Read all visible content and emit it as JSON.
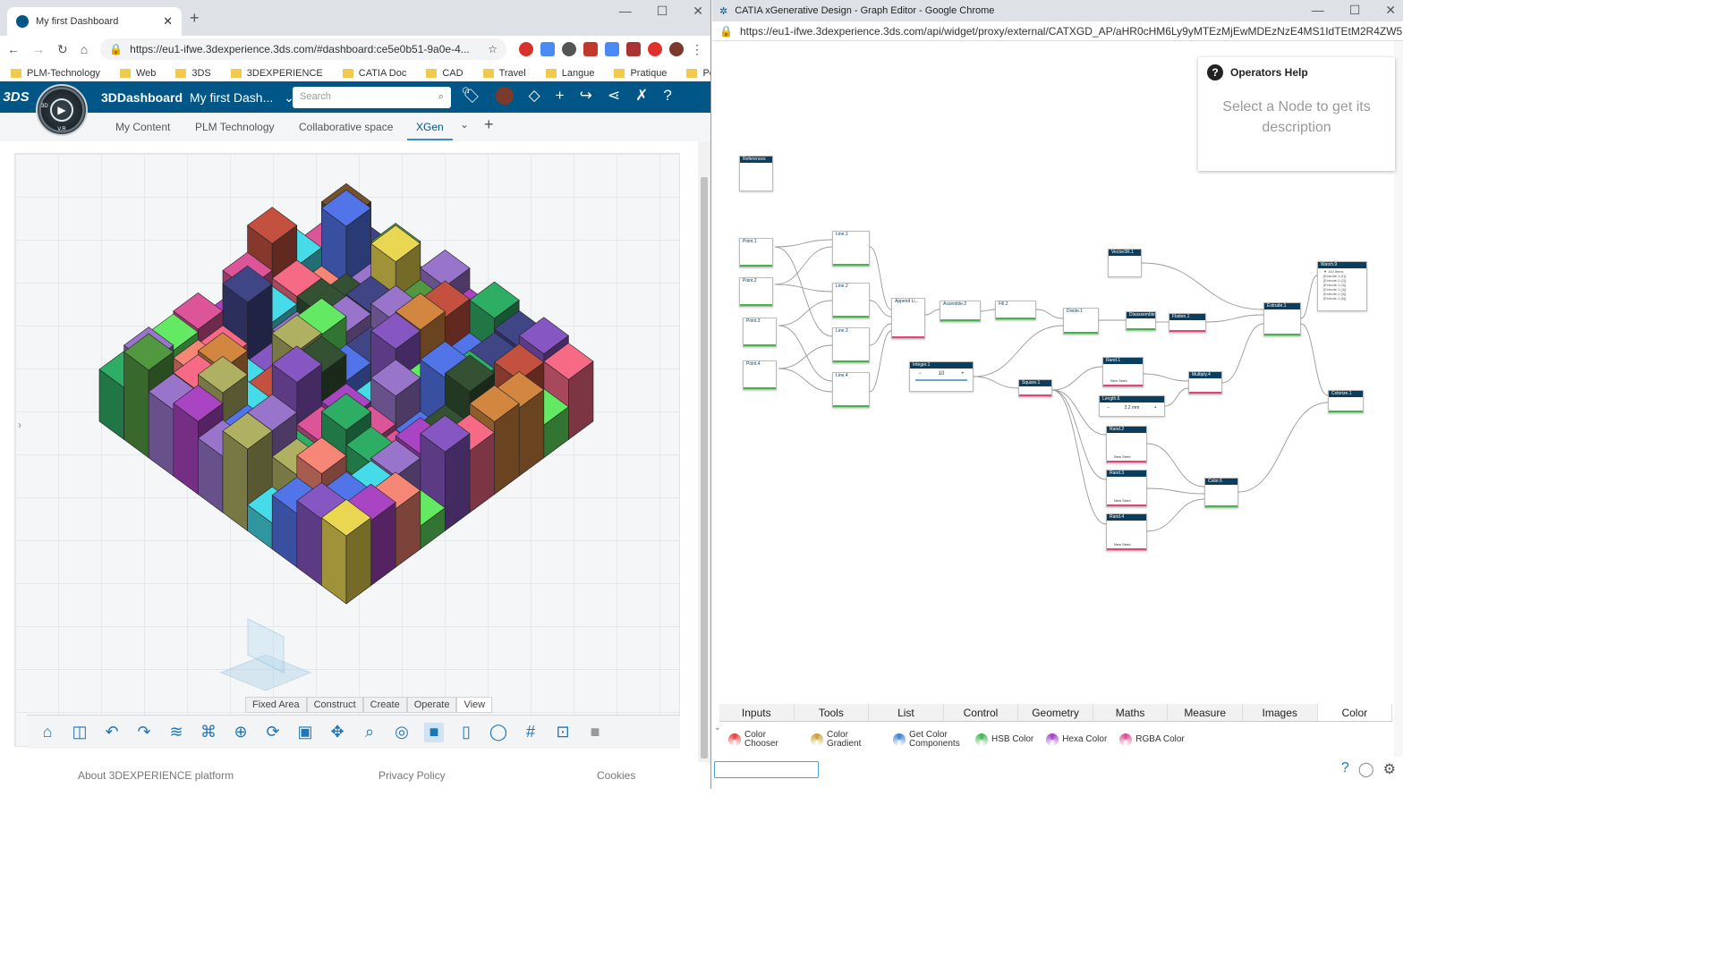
{
  "left_window": {
    "tab_title": "My first Dashboard",
    "url": "https://eu1-ifwe.3dexperience.3ds.com/#dashboard:ce5e0b51-9a0e-4...",
    "bookmarks": [
      "PLM-Technology",
      "Web",
      "3DS",
      "3DEXPERIENCE",
      "CATIA Doc",
      "CAD",
      "Travel",
      "Langue",
      "Pratique",
      "Personnel"
    ],
    "app_name": "3DDashboard",
    "dashboard_name": "My first Dash...",
    "search_placeholder": "Search",
    "compass_labels": {
      "top_left": "3D",
      "bottom": "V.R"
    },
    "dash_tabs": [
      "My Content",
      "PLM Technology",
      "Collaborative space",
      "XGen"
    ],
    "viewer_tabs": [
      "Fixed Area",
      "Construct",
      "Create",
      "Operate",
      "View"
    ],
    "active_viewer_tab": "View",
    "footer": [
      "About 3DEXPERIENCE platform",
      "Privacy Policy",
      "Cookies"
    ]
  },
  "right_window": {
    "title": "CATIA xGenerative Design - Graph Editor - Google Chrome",
    "url": "https://eu1-ifwe.3dexperience.3ds.com/api/widget/proxy/external/CATXGD_AP/aHR0cHM6Ly9yMTEzMjEwMDEzNzE4MS1IdTEtM2R4ZW5nYXB...",
    "help": {
      "title": "Operators Help",
      "text": "Select a Node to get its description"
    },
    "nodes": {
      "references": "References",
      "point1": "Point.1",
      "point2": "Point.2",
      "point3": "Point.3",
      "point4": "Point.4",
      "line1": "Line.1",
      "line2": "Line.2",
      "line3": "Line.3",
      "line4": "Line.4",
      "append": "Append Li...",
      "assemble": "Assemble.2",
      "fill": "Fill.2",
      "divide": "Divide.1",
      "disassemble": "Disassemble",
      "flatten": "Flatten.1",
      "vector": "Vector3R.1",
      "extrude": "Extrude.1",
      "watch": "Watch.9",
      "integer": "Integer.1",
      "integer_value": "10",
      "square": "Square.1",
      "rand1": "Rand.1",
      "rand2": "Rand.2",
      "rand3": "Rand.3",
      "rand4": "Rand.4",
      "length": "Length.6",
      "length_value": "2.2 mm",
      "multiply": "Multiply.4",
      "color": "Color.6",
      "colorize": "Colorize.1",
      "new_seed": "New Seed",
      "watch_items": [
        "▼ 100 items",
        "[Extrude.1 (1)]",
        "[Extrude.1 (2)]",
        "[Extrude.1 (3)]",
        "[Extrude.1 (4)]",
        "[Extrude.1 (5)]",
        "[Extrude.1 (6)]"
      ]
    },
    "categories": [
      "Inputs",
      "Tools",
      "List",
      "Control",
      "Geometry",
      "Maths",
      "Measure",
      "Images",
      "Color"
    ],
    "active_category": "Color",
    "color_items": [
      {
        "label": "Color Chooser",
        "color": "#e23d3d"
      },
      {
        "label": "Color Gradient",
        "color": "#c8a035"
      },
      {
        "label": "Get Color Components",
        "color": "#3b7fd1"
      },
      {
        "label": "HSB Color",
        "color": "#3fb34f"
      },
      {
        "label": "Hexa Color",
        "color": "#9b3fc7"
      },
      {
        "label": "RGBA Color",
        "color": "#d84c8f"
      }
    ]
  }
}
